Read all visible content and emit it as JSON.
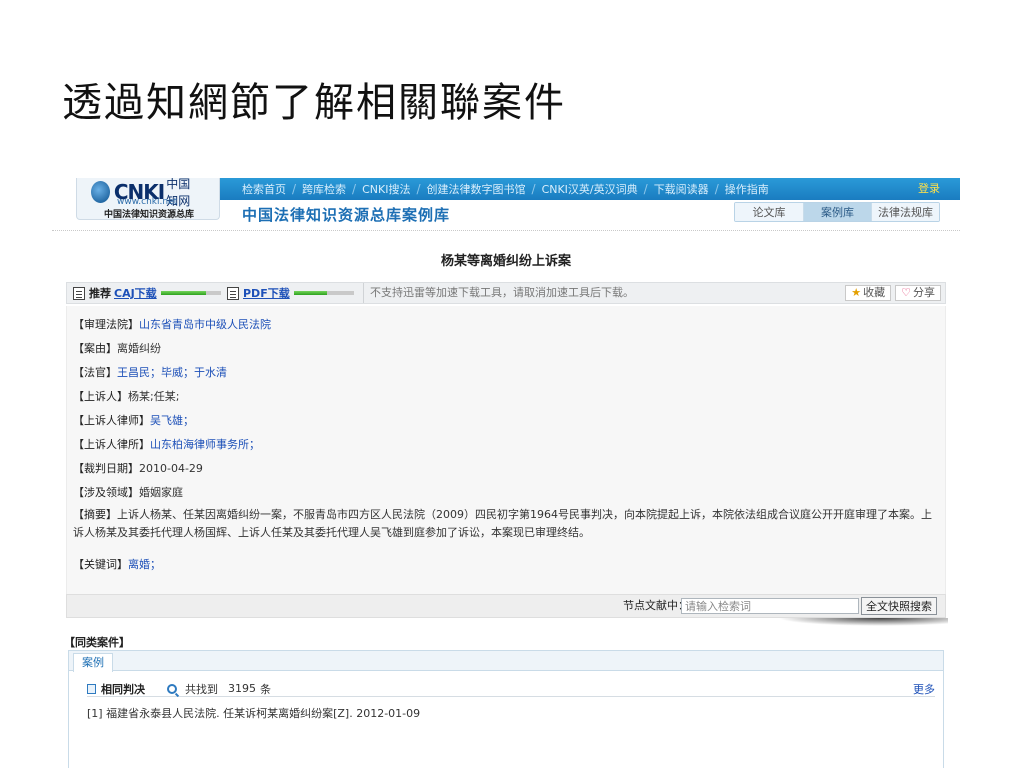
{
  "slide": {
    "title": "透過知網節了解相關聯案件"
  },
  "header": {
    "logo": {
      "text": "CNKI",
      "cn": "中国知网",
      "url": "www.cnki.net",
      "subtitle": "中国法律知识资源总库"
    },
    "nav": [
      "检索首页",
      "跨库检索",
      "CNKI搜法",
      "创建法律数字图书馆",
      "CNKI汉英/英汉词典",
      "下载阅读器",
      "操作指南"
    ],
    "login": "登录",
    "library_title": "中国法律知识资源总库案例库",
    "tabs": [
      {
        "label": "论文库",
        "active": false
      },
      {
        "label": "案例库",
        "active": true
      },
      {
        "label": "法律法规库",
        "active": false
      }
    ]
  },
  "case": {
    "title": "杨某等离婚纠纷上诉案",
    "toolbar": {
      "recommend_label": "推荐",
      "caj_link": "CAJ下载",
      "caj_progress": 0.75,
      "pdf_link": "PDF下载",
      "pdf_progress": 0.55,
      "notice": "不支持迅雷等加速下载工具，请取消加速工具后下载。",
      "favorite": "收藏",
      "share": "分享"
    },
    "fields": {
      "court": {
        "label": "【审理法院】",
        "value": "山东省青岛市中级人民法院"
      },
      "cause": {
        "label": "【案由】",
        "value": "离婚纠纷"
      },
      "judges": {
        "label": "【法官】",
        "value": "王昌民；毕威；于水清"
      },
      "appellant": {
        "label": "【上诉人】",
        "value": "杨某;任某;"
      },
      "appellant_lawyer": {
        "label": "【上诉人律师】",
        "value": "吴飞雄；"
      },
      "appellant_firm": {
        "label": "【上诉人律所】",
        "value": "山东柏海律师事务所；"
      },
      "judgment_date": {
        "label": "【裁判日期】",
        "value": "2010-04-29"
      },
      "field": {
        "label": "【涉及领域】",
        "value": "婚姻家庭"
      },
      "abstract": {
        "label": "【摘要】",
        "value": "上诉人杨某、任某因离婚纠纷一案，不服青岛市四方区人民法院（2009）四民初字第1964号民事判决，向本院提起上诉，本院依法组成合议庭公开开庭审理了本案。上诉人杨某及其委托代理人杨国辉、上诉人任某及其委托代理人吴飞雄到庭参加了诉讼，本案现已审理终结。"
      },
      "keywords": {
        "label": "【关键词】",
        "value": "离婚；"
      }
    },
    "search": {
      "label": "节点文献中：",
      "placeholder": "请输入检索词",
      "button": "全文快照搜索"
    }
  },
  "similar": {
    "title": "【同类案件】",
    "tab": "案例",
    "same_label": "相同判决",
    "found_text": "共找到",
    "found_count": "3195",
    "found_unit": "条",
    "more": "更多",
    "results": [
      {
        "index": "[1]",
        "text": "福建省永泰县人民法院. 任某诉柯某离婚纠纷案[Z]. 2012-01-09"
      }
    ]
  }
}
